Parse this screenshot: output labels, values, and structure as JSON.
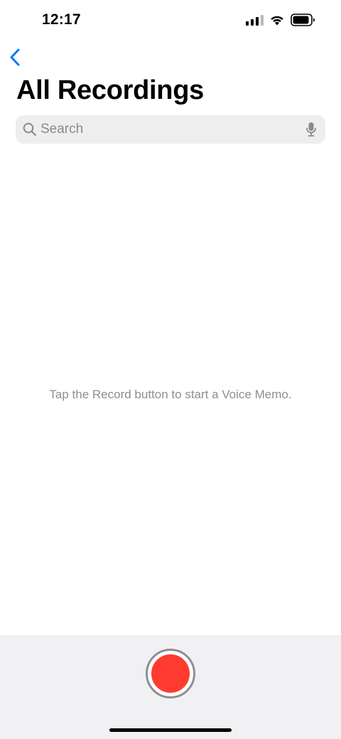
{
  "status_bar": {
    "time": "12:17",
    "signal_icon": "cellular-signal-icon",
    "wifi_icon": "wifi-icon",
    "battery_icon": "battery-icon"
  },
  "nav": {
    "back_icon": "chevron-left-icon",
    "accent_color": "#007aff"
  },
  "page": {
    "title": "All Recordings"
  },
  "search": {
    "placeholder": "Search",
    "value": "",
    "search_icon": "magnifying-glass-icon",
    "mic_icon": "microphone-icon"
  },
  "empty_state": {
    "message": "Tap the Record button to start a Voice Memo."
  },
  "record": {
    "record_color": "#ff3b30"
  }
}
